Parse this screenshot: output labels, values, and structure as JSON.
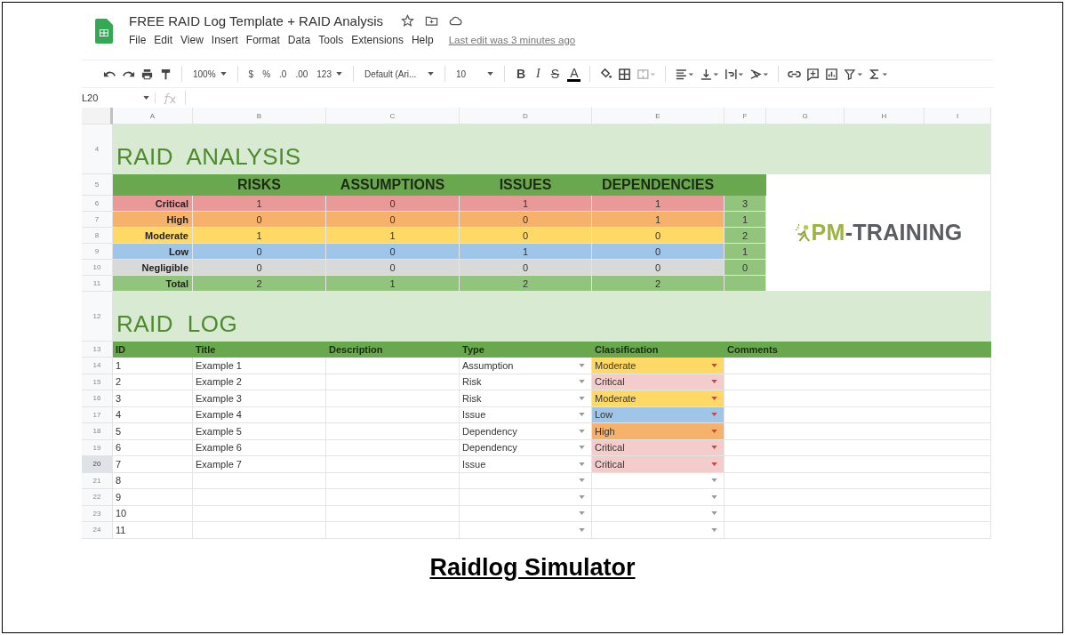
{
  "document": {
    "title": "FREE RAID Log Template + RAID Analysis",
    "menu": [
      "File",
      "Edit",
      "View",
      "Insert",
      "Format",
      "Data",
      "Tools",
      "Extensions",
      "Help"
    ],
    "last_edit": "Last edit was 3 minutes ago"
  },
  "toolbar": {
    "zoom": "100%",
    "currency": "$",
    "percent": "%",
    "decrease_decimals": ".0",
    "increase_decimals": ".00",
    "number_format": "123",
    "font": "Default (Ari...",
    "font_size": "10",
    "bold": "B",
    "italic": "I",
    "strikethrough": "S",
    "text_color": "A"
  },
  "name_box": "L20",
  "column_headers": [
    "A",
    "B",
    "C",
    "D",
    "E",
    "F",
    "G",
    "H",
    "I"
  ],
  "analysis": {
    "title_row": "4",
    "title": "RAID ANALYSIS",
    "header_row": "5",
    "columns": [
      "RISKS",
      "ASSUMPTIONS",
      "ISSUES",
      "DEPENDENCIES"
    ],
    "rows": [
      {
        "row": "6",
        "label": "Critical",
        "color": "#ea9999",
        "values": [
          "1",
          "0",
          "1",
          "1"
        ],
        "total": "3"
      },
      {
        "row": "7",
        "label": "High",
        "color": "#f6b26b",
        "values": [
          "0",
          "0",
          "0",
          "1"
        ],
        "total": "1"
      },
      {
        "row": "8",
        "label": "Moderate",
        "color": "#ffd966",
        "values": [
          "1",
          "1",
          "0",
          "0"
        ],
        "total": "2"
      },
      {
        "row": "9",
        "label": "Low",
        "color": "#9fc5e8",
        "values": [
          "0",
          "0",
          "1",
          "0"
        ],
        "total": "1"
      },
      {
        "row": "10",
        "label": "Negligible",
        "color": "#d9d9d9",
        "values": [
          "0",
          "0",
          "0",
          "0"
        ],
        "total": "0"
      }
    ],
    "total": {
      "row": "11",
      "label": "Total",
      "values": [
        "2",
        "1",
        "2",
        "2"
      ]
    }
  },
  "logo": {
    "accent": "PM",
    "rest": "-TRAINING"
  },
  "log": {
    "title_row": "12",
    "title": "RAID LOG",
    "header_row": "13",
    "columns": [
      "ID",
      "Title",
      "Description",
      "Type",
      "Classification",
      "Comments"
    ],
    "rows": [
      {
        "row": "14",
        "id": "1",
        "title": "Example 1",
        "type": "Assumption",
        "classification": "Moderate",
        "color": "#ffd966",
        "selected": false
      },
      {
        "row": "15",
        "id": "2",
        "title": "Example 2",
        "type": "Risk",
        "classification": "Critical",
        "color": "#f4cccc",
        "selected": false
      },
      {
        "row": "16",
        "id": "3",
        "title": "Example 3",
        "type": "Risk",
        "classification": "Moderate",
        "color": "#ffd966",
        "selected": false
      },
      {
        "row": "17",
        "id": "4",
        "title": "Example 4",
        "type": "Issue",
        "classification": "Low",
        "color": "#9fc5e8",
        "selected": false
      },
      {
        "row": "18",
        "id": "5",
        "title": "Example 5",
        "type": "Dependency",
        "classification": "High",
        "color": "#f6b26b",
        "selected": false
      },
      {
        "row": "19",
        "id": "6",
        "title": "Example 6",
        "type": "Dependency",
        "classification": "Critical",
        "color": "#f4cccc",
        "selected": false
      },
      {
        "row": "20",
        "id": "7",
        "title": "Example 7",
        "type": "Issue",
        "classification": "Critical",
        "color": "#f4cccc",
        "selected": true
      },
      {
        "row": "21",
        "id": "8",
        "selected": false
      },
      {
        "row": "22",
        "id": "9",
        "selected": false
      },
      {
        "row": "23",
        "id": "10",
        "selected": false
      },
      {
        "row": "24",
        "id": "11",
        "selected": false
      }
    ]
  },
  "caption": "Raidlog Simulator"
}
